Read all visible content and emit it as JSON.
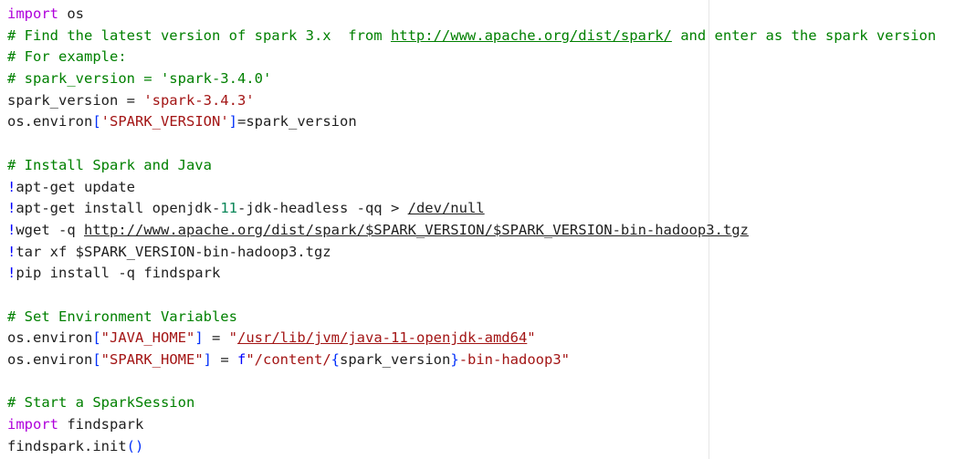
{
  "editor": {
    "lines": [
      [
        {
          "t": "import",
          "c": "kw"
        },
        {
          "t": " os",
          "c": ""
        }
      ],
      [
        {
          "t": "# Find the latest version of spark 3.x  from ",
          "c": "cm"
        },
        {
          "t": "http://www.apache.org/dist/spark/",
          "c": "cm link"
        },
        {
          "t": " and enter as the spark version",
          "c": "cm"
        }
      ],
      [
        {
          "t": "# For example:",
          "c": "cm"
        }
      ],
      [
        {
          "t": "# spark_version = 'spark-3.4.0'",
          "c": "cm"
        }
      ],
      [
        {
          "t": "spark_version = ",
          "c": ""
        },
        {
          "t": "'spark-3.4.3'",
          "c": "str"
        }
      ],
      [
        {
          "t": "os.environ",
          "c": ""
        },
        {
          "t": "[",
          "c": "punc"
        },
        {
          "t": "'SPARK_VERSION'",
          "c": "str"
        },
        {
          "t": "]",
          "c": "punc"
        },
        {
          "t": "=spark_version",
          "c": ""
        }
      ],
      [],
      [
        {
          "t": "# Install Spark and Java",
          "c": "cm"
        }
      ],
      [
        {
          "t": "!",
          "c": "bang"
        },
        {
          "t": "apt-get update",
          "c": ""
        }
      ],
      [
        {
          "t": "!",
          "c": "bang"
        },
        {
          "t": "apt-get install openjdk-",
          "c": ""
        },
        {
          "t": "11",
          "c": "num"
        },
        {
          "t": "-jdk-headless -qq > ",
          "c": ""
        },
        {
          "t": "/dev/null",
          "c": "ulink"
        }
      ],
      [
        {
          "t": "!",
          "c": "bang"
        },
        {
          "t": "wget -q ",
          "c": ""
        },
        {
          "t": "http://www.apache.org/dist/spark/$SPARK_VERSION/$SPARK_VERSION-bin-hadoop3.tgz",
          "c": "ulink"
        }
      ],
      [
        {
          "t": "!",
          "c": "bang"
        },
        {
          "t": "tar xf $SPARK_VERSION-bin-hadoop3.tgz",
          "c": ""
        }
      ],
      [
        {
          "t": "!",
          "c": "bang"
        },
        {
          "t": "pip install -q findspark",
          "c": ""
        }
      ],
      [],
      [
        {
          "t": "# Set Environment Variables",
          "c": "cm"
        }
      ],
      [
        {
          "t": "os.environ",
          "c": ""
        },
        {
          "t": "[",
          "c": "punc"
        },
        {
          "t": "\"JAVA_HOME\"",
          "c": "str"
        },
        {
          "t": "]",
          "c": "punc"
        },
        {
          "t": " = ",
          "c": ""
        },
        {
          "t": "\"",
          "c": "str"
        },
        {
          "t": "/usr/lib/jvm/java-11-openjdk-amd64",
          "c": "str ulink"
        },
        {
          "t": "\"",
          "c": "str"
        }
      ],
      [
        {
          "t": "os.environ",
          "c": ""
        },
        {
          "t": "[",
          "c": "punc"
        },
        {
          "t": "\"SPARK_HOME\"",
          "c": "str"
        },
        {
          "t": "]",
          "c": "punc"
        },
        {
          "t": " = ",
          "c": ""
        },
        {
          "t": "f",
          "c": "fpre"
        },
        {
          "t": "\"/content/",
          "c": "str"
        },
        {
          "t": "{",
          "c": "punc"
        },
        {
          "t": "spark_version",
          "c": ""
        },
        {
          "t": "}",
          "c": "punc"
        },
        {
          "t": "-bin-hadoop3\"",
          "c": "str"
        }
      ],
      [],
      [
        {
          "t": "# Start a SparkSession",
          "c": "cm"
        }
      ],
      [
        {
          "t": "import",
          "c": "kw"
        },
        {
          "t": " findspark",
          "c": ""
        }
      ],
      [
        {
          "t": "findspark.init",
          "c": ""
        },
        {
          "t": "()",
          "c": "punc"
        }
      ]
    ]
  },
  "colors": {
    "keyword": "#af00db",
    "comment": "#008000",
    "string": "#a31515",
    "bracket": "#0431fa",
    "number": "#098658",
    "text": "#1f1f1f",
    "ruler": "#e6e6e6"
  }
}
